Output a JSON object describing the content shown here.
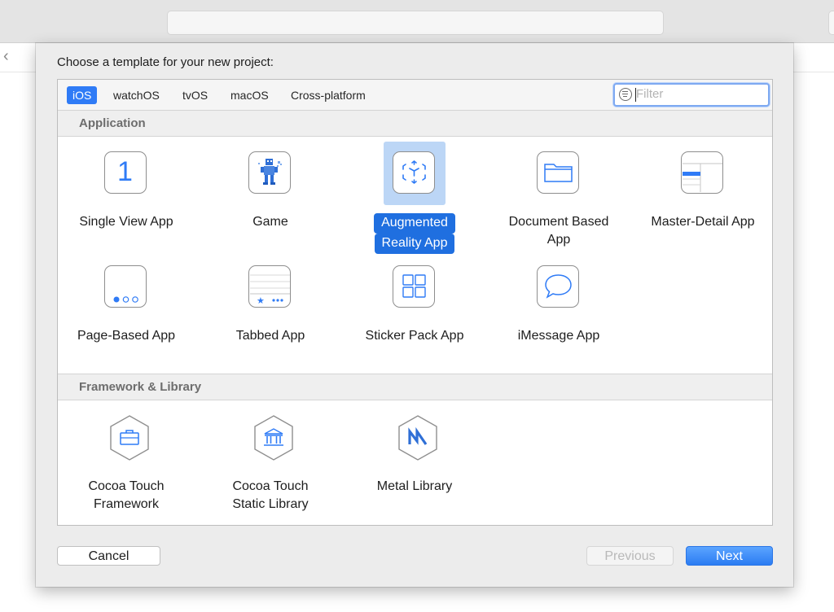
{
  "window": {
    "nav_arrows": "‹ ›"
  },
  "dialog": {
    "title": "Choose a template for your new project:",
    "tabs": [
      {
        "label": "iOS",
        "active": true
      },
      {
        "label": "watchOS",
        "active": false
      },
      {
        "label": "tvOS",
        "active": false
      },
      {
        "label": "macOS",
        "active": false
      },
      {
        "label": "Cross-platform",
        "active": false
      }
    ],
    "filter": {
      "placeholder": "Filter",
      "value": "",
      "icon": "filter-icon"
    },
    "sections": [
      {
        "title": "Application",
        "items": [
          {
            "label_lines": [
              "Single View App"
            ],
            "icon": "single-view-icon",
            "selected": false
          },
          {
            "label_lines": [
              "Game"
            ],
            "icon": "game-icon",
            "selected": false
          },
          {
            "label_lines": [
              "Augmented",
              "Reality App"
            ],
            "icon": "ar-cube-icon",
            "selected": true
          },
          {
            "label_lines": [
              "Document Based",
              "App"
            ],
            "icon": "folder-icon",
            "selected": false
          },
          {
            "label_lines": [
              "Master-Detail App"
            ],
            "icon": "master-detail-icon",
            "selected": false
          },
          {
            "label_lines": [
              "Page-Based App"
            ],
            "icon": "page-dots-icon",
            "selected": false
          },
          {
            "label_lines": [
              "Tabbed App"
            ],
            "icon": "tab-bar-icon",
            "selected": false
          },
          {
            "label_lines": [
              "Sticker Pack App"
            ],
            "icon": "sticker-grid-icon",
            "selected": false
          },
          {
            "label_lines": [
              "iMessage App"
            ],
            "icon": "message-bubble-icon",
            "selected": false
          }
        ]
      },
      {
        "title": "Framework & Library",
        "items": [
          {
            "label_lines": [
              "Cocoa Touch",
              "Framework"
            ],
            "icon": "toolbox-icon",
            "selected": false
          },
          {
            "label_lines": [
              "Cocoa Touch",
              "Static Library"
            ],
            "icon": "library-building-icon",
            "selected": false
          },
          {
            "label_lines": [
              "Metal Library"
            ],
            "icon": "metal-icon",
            "selected": false
          }
        ]
      }
    ],
    "single_view_glyph": "1",
    "buttons": {
      "cancel": "Cancel",
      "previous": "Previous",
      "next": "Next"
    }
  },
  "colors": {
    "accent": "#2f7bf6",
    "selection_bg": "#bcd6f6",
    "selection_label": "#1f6fe0"
  }
}
